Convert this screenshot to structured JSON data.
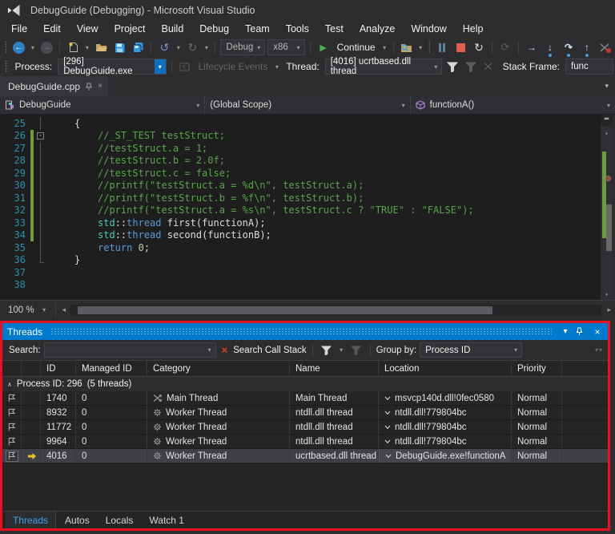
{
  "icons": {
    "caret": "▾",
    "close": "×",
    "pin_tooltip": "pin",
    "up_arrow": "▴",
    "down_arrow": "▾",
    "left_arrow": "◂",
    "right_arrow": "▸",
    "back_arrow": "←",
    "fwd_arrow": "→",
    "undo": "↺",
    "redo": "↻",
    "restart": "↻",
    "run_dim": "⟳",
    "step_next": "→",
    "step_into": "↓",
    "step_out": "↑",
    "step_over": "↷",
    "group_caret": "∧",
    "minus": "-",
    "split": "═",
    "overflow": "▾▾"
  },
  "title_bar": {
    "title": "DebugGuide (Debugging) - Microsoft Visual Studio"
  },
  "menu": {
    "items": [
      "File",
      "Edit",
      "View",
      "Project",
      "Build",
      "Debug",
      "Team",
      "Tools",
      "Test",
      "Analyze",
      "Window",
      "Help"
    ]
  },
  "toolbar": {
    "config_value": "Debug",
    "platform_value": "x86",
    "continue_label": "Continue"
  },
  "debug_bar": {
    "process_label": "Process:",
    "process_value": "[296] DebugGuide.exe",
    "lifecycle_label": "Lifecycle Events",
    "thread_label": "Thread:",
    "thread_value": "[4016] ucrtbased.dll thread",
    "stack_frame_label": "Stack Frame:",
    "stack_frame_value": "func"
  },
  "editor": {
    "tab_title": "DebugGuide.cpp",
    "nav": {
      "project": "DebugGuide",
      "scope": "(Global Scope)",
      "member": "functionA()"
    },
    "zoom_value": "100 %",
    "lines": [
      {
        "num": "25",
        "indent": 1,
        "changed": false,
        "fold": "line",
        "tokens": [
          {
            "c": "pl",
            "t": "{"
          }
        ]
      },
      {
        "num": "26",
        "indent": 2,
        "changed": true,
        "fold": "box",
        "tokens": [
          {
            "c": "cm",
            "t": "//_ST_TEST testStruct;"
          }
        ]
      },
      {
        "num": "27",
        "indent": 2,
        "changed": true,
        "fold": "line",
        "tokens": [
          {
            "c": "cm",
            "t": "//testStruct.a = 1;"
          }
        ]
      },
      {
        "num": "28",
        "indent": 2,
        "changed": true,
        "fold": "line",
        "tokens": [
          {
            "c": "cm",
            "t": "//testStruct.b = 2.0f;"
          }
        ]
      },
      {
        "num": "29",
        "indent": 2,
        "changed": true,
        "fold": "line",
        "tokens": [
          {
            "c": "cm",
            "t": "//testStruct.c = false;"
          }
        ]
      },
      {
        "num": "30",
        "indent": 2,
        "changed": true,
        "fold": "line",
        "tokens": [
          {
            "c": "cm",
            "t": "//printf(\"testStruct.a = %d\\n\", testStruct.a);"
          }
        ]
      },
      {
        "num": "31",
        "indent": 2,
        "changed": true,
        "fold": "line",
        "tokens": [
          {
            "c": "cm",
            "t": "//printf(\"testStruct.b = %f\\n\", testStruct.b);"
          }
        ]
      },
      {
        "num": "32",
        "indent": 2,
        "changed": true,
        "fold": "line",
        "tokens": [
          {
            "c": "cm",
            "t": "//printf(\"testStruct.a = %s\\n\", testStruct.c ? \"TRUE\" : \"FALSE\");"
          }
        ]
      },
      {
        "num": "33",
        "indent": 2,
        "changed": true,
        "fold": "line",
        "tokens": [
          {
            "c": "ty",
            "t": "std"
          },
          {
            "c": "pl",
            "t": "::"
          },
          {
            "c": "kw",
            "t": "thread"
          },
          {
            "c": "pl",
            "t": " first(functionA);"
          }
        ]
      },
      {
        "num": "34",
        "indent": 2,
        "changed": true,
        "fold": "line",
        "tokens": [
          {
            "c": "ty",
            "t": "std"
          },
          {
            "c": "pl",
            "t": "::"
          },
          {
            "c": "kw",
            "t": "thread"
          },
          {
            "c": "pl",
            "t": " second(functionB);"
          }
        ]
      },
      {
        "num": "35",
        "indent": 2,
        "changed": false,
        "fold": "line",
        "tokens": [
          {
            "c": "kw",
            "t": "return"
          },
          {
            "c": "pl",
            "t": " "
          },
          {
            "c": "num",
            "t": "0"
          },
          {
            "c": "pl",
            "t": ";"
          }
        ]
      },
      {
        "num": "36",
        "indent": 1,
        "changed": false,
        "fold": "end",
        "tokens": [
          {
            "c": "pl",
            "t": "}"
          }
        ]
      },
      {
        "num": "37",
        "indent": 0,
        "changed": false,
        "fold": "",
        "tokens": []
      },
      {
        "num": "38",
        "indent": 0,
        "changed": false,
        "fold": "",
        "tokens": []
      }
    ]
  },
  "threads_panel": {
    "title": "Threads",
    "search_label": "Search:",
    "search_value": "",
    "search_call_stack_label": "Search Call Stack",
    "group_by_label": "Group by:",
    "group_by_value": "Process ID",
    "columns": [
      "ID",
      "Managed ID",
      "Category",
      "Name",
      "Location",
      "Priority"
    ],
    "group_row": {
      "label": "Process ID: 296",
      "count": "(5 threads)"
    },
    "rows": [
      {
        "flag": true,
        "current": false,
        "selected": false,
        "id": "1740",
        "managed_id": "0",
        "category": "Main Thread",
        "category_icon": "main-thread",
        "name": "Main Thread",
        "location": "msvcp140d.dll!0fec0580",
        "priority": "Normal"
      },
      {
        "flag": true,
        "current": false,
        "selected": false,
        "id": "8932",
        "managed_id": "0",
        "category": "Worker Thread",
        "category_icon": "worker-thread",
        "name": "ntdll.dll thread",
        "location": "ntdll.dll!779804bc",
        "priority": "Normal"
      },
      {
        "flag": true,
        "current": false,
        "selected": false,
        "id": "11772",
        "managed_id": "0",
        "category": "Worker Thread",
        "category_icon": "worker-thread",
        "name": "ntdll.dll thread",
        "location": "ntdll.dll!779804bc",
        "priority": "Normal"
      },
      {
        "flag": true,
        "current": false,
        "selected": false,
        "id": "9964",
        "managed_id": "0",
        "category": "Worker Thread",
        "category_icon": "worker-thread",
        "name": "ntdll.dll thread",
        "location": "ntdll.dll!779804bc",
        "priority": "Normal"
      },
      {
        "flag": true,
        "current": true,
        "selected": true,
        "id": "4016",
        "managed_id": "0",
        "category": "Worker Thread",
        "category_icon": "worker-thread",
        "name": "ucrtbased.dll thread",
        "location": "DebugGuide.exe!functionA",
        "priority": "Normal"
      }
    ],
    "tabs": [
      {
        "label": "Threads",
        "active": true
      },
      {
        "label": "Autos",
        "active": false
      },
      {
        "label": "Locals",
        "active": false
      },
      {
        "label": "Watch 1",
        "active": false
      }
    ]
  },
  "colors": {
    "accent_blue": "#007acc",
    "highlight_red_border": "#e81123",
    "change_bar_green": "#6f9c3f",
    "comment_green": "#57a64a",
    "keyword_blue": "#569cd6",
    "type_teal": "#4ec9b0",
    "line_number_blue": "#2b91af",
    "stop_red": "#dd5f4c",
    "continue_green": "#4cb04f",
    "current_thread_yellow": "#edc425"
  }
}
